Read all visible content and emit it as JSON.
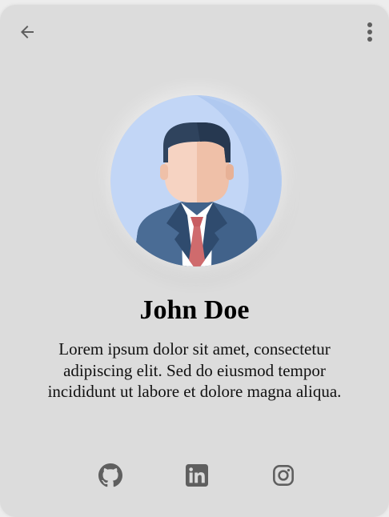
{
  "profile": {
    "name": "John Doe",
    "bio": "Lorem ipsum dolor sit amet, consectetur adipiscing elit. Sed do eiusmod tempor incididunt ut labore et dolore magna aliqua."
  },
  "icons": {
    "back": "arrow-left-icon",
    "menu": "more-vertical-icon",
    "social": [
      "github-icon",
      "linkedin-icon",
      "instagram-icon"
    ]
  },
  "colors": {
    "card_background": "#dcdcdc",
    "icon": "#5f5f5f",
    "avatar_background": "#c9dcf7",
    "suit": "#3f5f86",
    "tie": "#d16d6d"
  }
}
